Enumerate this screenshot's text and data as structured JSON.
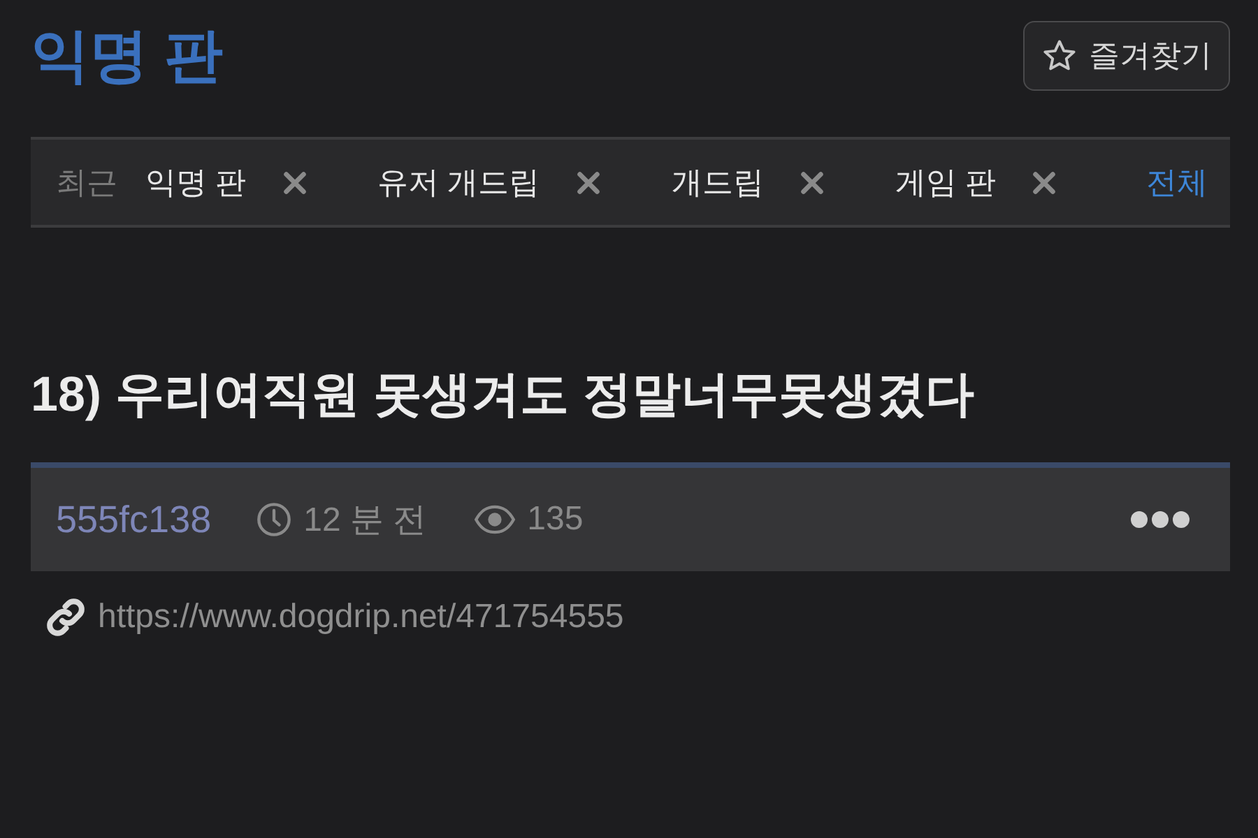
{
  "board_title": "익명 판",
  "favorite_button": {
    "label": "즐겨찾기"
  },
  "recent": {
    "label": "최근",
    "items": [
      {
        "label": "익명 판"
      },
      {
        "label": "유저 개드립"
      },
      {
        "label": "개드립"
      },
      {
        "label": "게임 판"
      }
    ],
    "all_link": "전체"
  },
  "post": {
    "title": "18) 우리여직원 못생겨도 정말너무못생겼다",
    "author": "555fc138",
    "time": "12 분 전",
    "views": "135",
    "url": "https://www.dogdrip.net/471754555"
  }
}
